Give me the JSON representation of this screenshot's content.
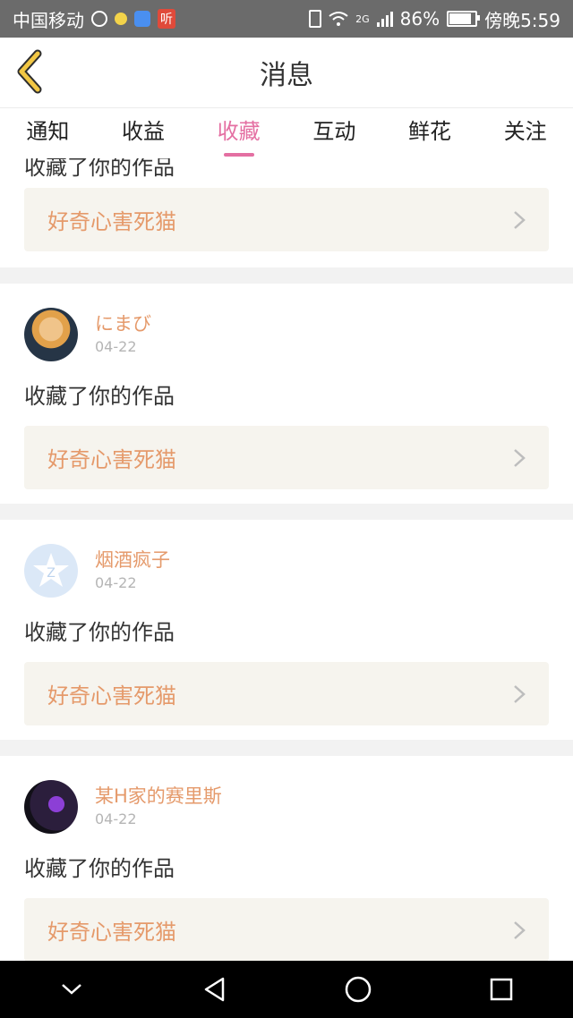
{
  "statusbar": {
    "carrier": "中国移动",
    "app_badge": "听",
    "network": "2G",
    "battery": "86%",
    "battery_level": 0.86,
    "time": "傍晚5:59"
  },
  "header": {
    "title": "消息"
  },
  "tabs": [
    {
      "label": "通知"
    },
    {
      "label": "收益"
    },
    {
      "label": "收藏"
    },
    {
      "label": "互动"
    },
    {
      "label": "鲜花"
    },
    {
      "label": "关注"
    }
  ],
  "active_tab": "收藏",
  "feed": {
    "partial": {
      "action": "收藏了你的作品",
      "work": "好奇心害死猫"
    },
    "items": [
      {
        "user": "にまび",
        "date": "04-22",
        "action": "收藏了你的作品",
        "work": "好奇心害死猫"
      },
      {
        "user": "烟酒疯子",
        "date": "04-22",
        "action": "收藏了你的作品",
        "work": "好奇心害死猫"
      },
      {
        "user": "某H家的赛里斯",
        "date": "04-22",
        "action": "收藏了你的作品",
        "work": "好奇心害死猫"
      }
    ]
  },
  "colors": {
    "accent": "#e46fa2",
    "username": "#e59a6b",
    "work_box": "#f6f4ee",
    "back_icon": "#f2c744"
  },
  "icons": {
    "back": "back-chevron-icon",
    "item_arrow": "chevron-right-icon",
    "nav": [
      "collapse-icon",
      "back-triangle-icon",
      "home-circle-icon",
      "recents-square-icon"
    ]
  }
}
